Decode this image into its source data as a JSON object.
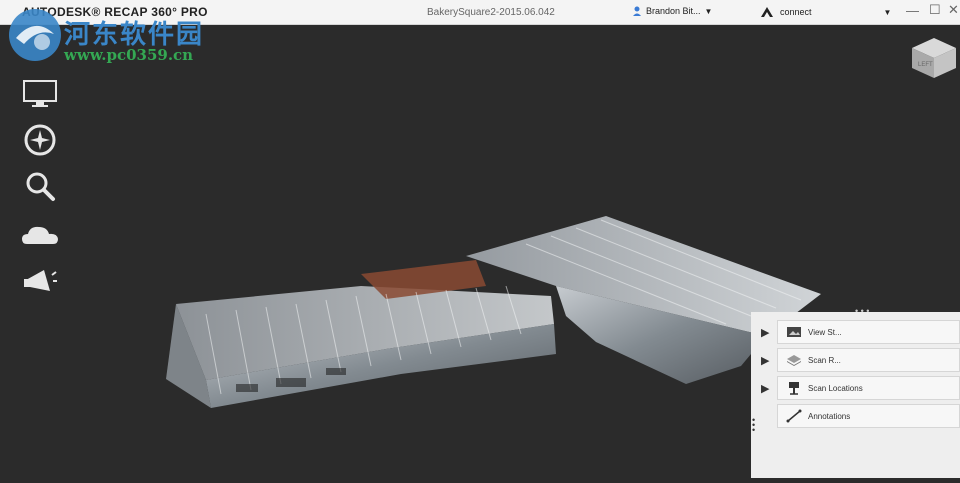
{
  "app": {
    "title": "AUTODESK® RECAP 360° PRO",
    "document": "BakerySquare2-2015.06.042"
  },
  "user": {
    "name": "Brandon Bit..."
  },
  "connect": {
    "label": "connect"
  },
  "watermark": {
    "title": "河东软件园",
    "url": "www.pc0359.cn"
  },
  "tools": [
    "display-icon",
    "compass-icon",
    "search-icon",
    "cloud-icon",
    "megaphone-icon"
  ],
  "cube": {
    "label": "LEFT"
  },
  "panel": {
    "items": [
      {
        "label": "View St...",
        "icon": "image-icon"
      },
      {
        "label": "Scan R...",
        "icon": "layers-icon"
      },
      {
        "label": "Scan Locations",
        "icon": "scanner-icon"
      },
      {
        "label": "Annotations",
        "icon": "measure-icon"
      }
    ]
  },
  "colors": {
    "background": "#2b2b2b",
    "titlebar": "#f4f4f4",
    "panel": "#eeeeee"
  }
}
